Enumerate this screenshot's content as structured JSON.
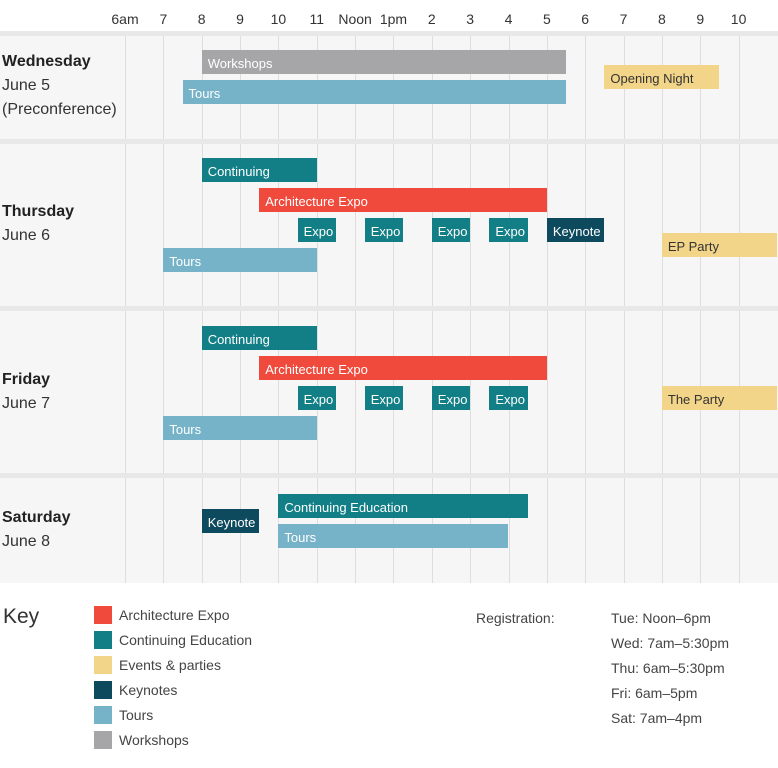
{
  "chart_data": {
    "type": "gantt",
    "hours": [
      {
        "h": 6,
        "label": "6am"
      },
      {
        "h": 7,
        "label": "7"
      },
      {
        "h": 8,
        "label": "8"
      },
      {
        "h": 9,
        "label": "9"
      },
      {
        "h": 10,
        "label": "10"
      },
      {
        "h": 11,
        "label": "11"
      },
      {
        "h": 12,
        "label": "Noon"
      },
      {
        "h": 13,
        "label": "1pm"
      },
      {
        "h": 14,
        "label": "2"
      },
      {
        "h": 15,
        "label": "3"
      },
      {
        "h": 16,
        "label": "4"
      },
      {
        "h": 17,
        "label": "5"
      },
      {
        "h": 18,
        "label": "6"
      },
      {
        "h": 19,
        "label": "7"
      },
      {
        "h": 20,
        "label": "8"
      },
      {
        "h": 21,
        "label": "9"
      },
      {
        "h": 22,
        "label": "10"
      }
    ],
    "categories": {
      "expo": {
        "name": "Architecture Expo",
        "color": "#f04a3c"
      },
      "ce": {
        "name": "Continuing Education",
        "color": "#127f86"
      },
      "events": {
        "name": "Events & parties",
        "color": "#f3d589"
      },
      "keynote": {
        "name": "Keynotes",
        "color": "#0d4a5e"
      },
      "tours": {
        "name": "Tours",
        "color": "#76b3c8"
      },
      "workshops": {
        "name": "Workshops",
        "color": "#a6a6a8"
      }
    },
    "days": [
      {
        "name": "Wednesday",
        "sub": [
          "June 5",
          "(Preconference)"
        ],
        "events": [
          {
            "label": "Workshops",
            "cat": "workshops",
            "start": 8,
            "end": 17.5,
            "row": 0
          },
          {
            "label": "Tours",
            "cat": "tours",
            "start": 7.5,
            "end": 17.5,
            "row": 1
          },
          {
            "label": "Opening Night",
            "cat": "events",
            "start": 18.5,
            "end": 21.5,
            "row": 0.5
          }
        ]
      },
      {
        "name": "Thursday",
        "sub": [
          "June 6"
        ],
        "events": [
          {
            "label": "Continuing",
            "cat": "ce",
            "start": 8,
            "end": 11,
            "row": 0
          },
          {
            "label": "Architecture Expo",
            "cat": "expo",
            "start": 9.5,
            "end": 17,
            "row": 1
          },
          {
            "label": "Expo",
            "cat": "ce",
            "start": 10.5,
            "end": 11.5,
            "row": 2
          },
          {
            "label": "Expo",
            "cat": "ce",
            "start": 12.25,
            "end": 13.25,
            "row": 2
          },
          {
            "label": "Expo",
            "cat": "ce",
            "start": 14,
            "end": 15,
            "row": 2
          },
          {
            "label": "Expo",
            "cat": "ce",
            "start": 15.5,
            "end": 16.5,
            "row": 2
          },
          {
            "label": "Keynote",
            "cat": "keynote",
            "start": 17,
            "end": 18.5,
            "row": 2
          },
          {
            "label": "Tours",
            "cat": "tours",
            "start": 7,
            "end": 11,
            "row": 3
          },
          {
            "label": "EP Party",
            "cat": "events",
            "start": 20,
            "end": 23,
            "row": 2.5
          }
        ]
      },
      {
        "name": "Friday",
        "sub": [
          "June 7"
        ],
        "events": [
          {
            "label": "Continuing",
            "cat": "ce",
            "start": 8,
            "end": 11,
            "row": 0
          },
          {
            "label": "Architecture Expo",
            "cat": "expo",
            "start": 9.5,
            "end": 17,
            "row": 1
          },
          {
            "label": "Expo",
            "cat": "ce",
            "start": 10.5,
            "end": 11.5,
            "row": 2
          },
          {
            "label": "Expo",
            "cat": "ce",
            "start": 12.25,
            "end": 13.25,
            "row": 2
          },
          {
            "label": "Expo",
            "cat": "ce",
            "start": 14,
            "end": 15,
            "row": 2
          },
          {
            "label": "Expo",
            "cat": "ce",
            "start": 15.5,
            "end": 16.5,
            "row": 2
          },
          {
            "label": "Tours",
            "cat": "tours",
            "start": 7,
            "end": 11,
            "row": 3
          },
          {
            "label": "The Party",
            "cat": "events",
            "start": 20,
            "end": 23,
            "row": 2
          }
        ]
      },
      {
        "name": "Saturday",
        "sub": [
          "June 8"
        ],
        "events": [
          {
            "label": "Keynote",
            "cat": "keynote",
            "start": 8,
            "end": 9.5,
            "row": 0.5
          },
          {
            "label": "Continuing Education",
            "cat": "ce",
            "start": 10,
            "end": 16.5,
            "row": 0
          },
          {
            "label": "Tours",
            "cat": "tours",
            "start": 10,
            "end": 16,
            "row": 1
          }
        ]
      }
    ]
  },
  "key": {
    "title": "Key",
    "items": [
      {
        "cat": "expo",
        "label": "Architecture Expo"
      },
      {
        "cat": "ce",
        "label": "Continuing Education"
      },
      {
        "cat": "events",
        "label": "Events & parties"
      },
      {
        "cat": "keynote",
        "label": "Keynotes"
      },
      {
        "cat": "tours",
        "label": "Tours"
      },
      {
        "cat": "workshops",
        "label": "Workshops"
      }
    ]
  },
  "registration": {
    "label": "Registration:",
    "lines": [
      "Tue: Noon–6pm",
      "Wed: 7am–5:30pm",
      "Thu: 6am–5:30pm",
      "Fri: 6am–5pm",
      "Sat: 7am–4pm"
    ]
  }
}
